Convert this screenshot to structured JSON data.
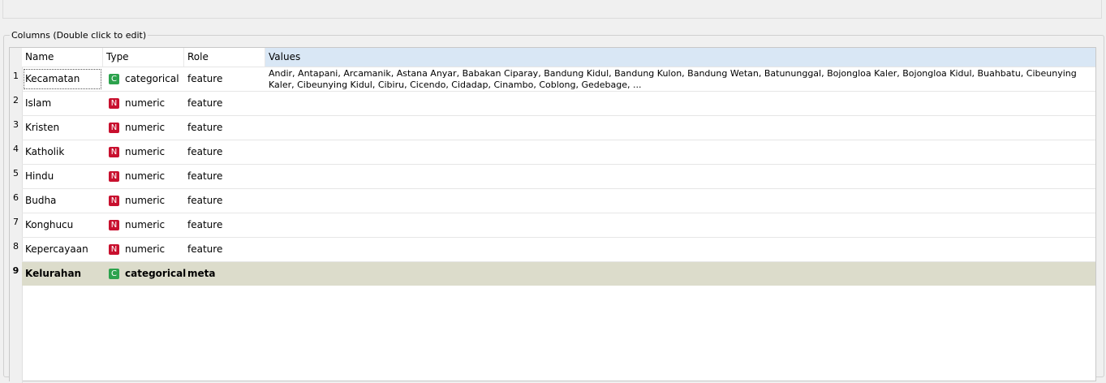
{
  "group_title": "Columns (Double click to edit)",
  "headers": {
    "name": "Name",
    "type": "Type",
    "role": "Role",
    "values": "Values"
  },
  "rows": [
    {
      "num": "1",
      "name": "Kecamatan",
      "type_icon": "C",
      "type": "categorical",
      "role": "feature",
      "values": "Andir, Antapani, Arcamanik, Astana Anyar, Babakan Ciparay, Bandung Kidul, Bandung Kulon, Bandung Wetan, Batununggal, Bojongloa Kaler, Bojongloa Kidul, Buahbatu, Cibeunying Kaler, Cibeunying Kidul, Cibiru, Cicendo, Cidadap, Cinambo, Coblong, Gedebage, ..."
    },
    {
      "num": "2",
      "name": "Islam",
      "type_icon": "N",
      "type": "numeric",
      "role": "feature",
      "values": ""
    },
    {
      "num": "3",
      "name": "Kristen",
      "type_icon": "N",
      "type": "numeric",
      "role": "feature",
      "values": ""
    },
    {
      "num": "4",
      "name": "Katholik",
      "type_icon": "N",
      "type": "numeric",
      "role": "feature",
      "values": ""
    },
    {
      "num": "5",
      "name": "Hindu",
      "type_icon": "N",
      "type": "numeric",
      "role": "feature",
      "values": ""
    },
    {
      "num": "6",
      "name": "Budha",
      "type_icon": "N",
      "type": "numeric",
      "role": "feature",
      "values": ""
    },
    {
      "num": "7",
      "name": "Konghucu",
      "type_icon": "N",
      "type": "numeric",
      "role": "feature",
      "values": ""
    },
    {
      "num": "8",
      "name": "Kepercayaan",
      "type_icon": "N",
      "type": "numeric",
      "role": "feature",
      "values": ""
    },
    {
      "num": "9",
      "name": "Kelurahan",
      "type_icon": "C",
      "type": "categorical",
      "role": "meta",
      "values": ""
    }
  ],
  "colors": {
    "categorical": "#2ca24d",
    "numeric": "#c8102e",
    "meta_row": "#dcdccb",
    "values_header": "#d9e7f5"
  }
}
